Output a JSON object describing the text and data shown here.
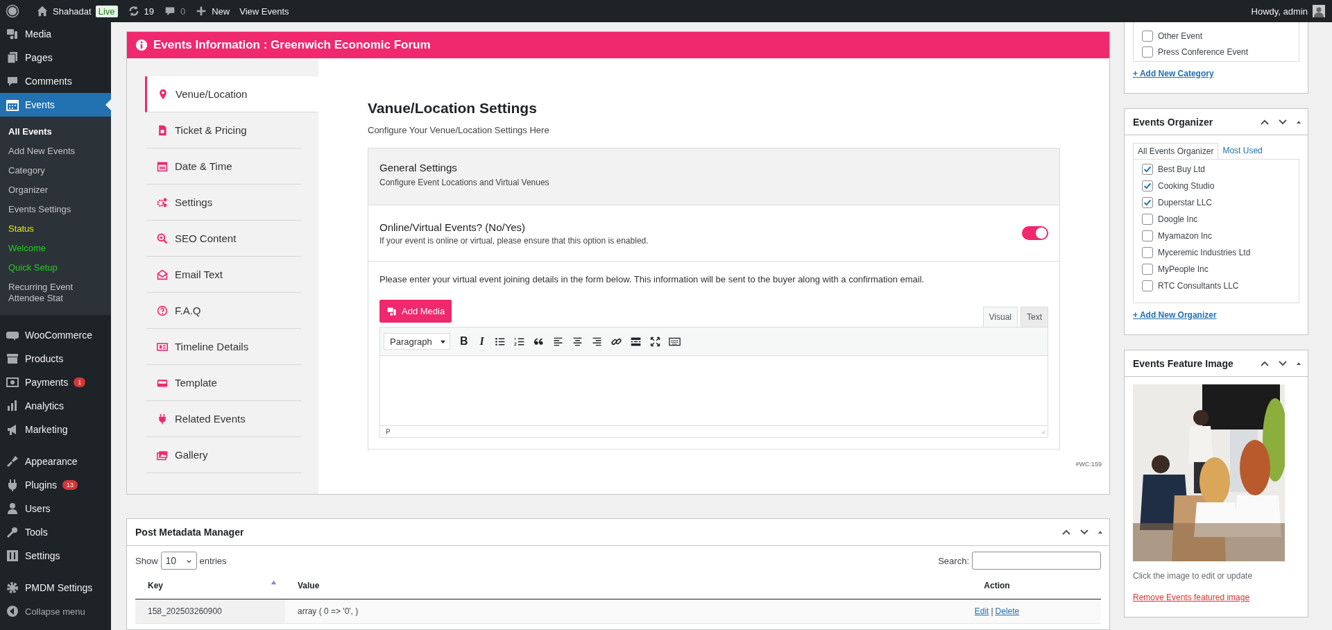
{
  "admin_bar": {
    "site_name": "Shahadat",
    "live_badge": "Live",
    "updates_count": "19",
    "comments_count": "0",
    "new_label": "New",
    "view_label": "View Events",
    "greeting": "Howdy, admin"
  },
  "sidebar": {
    "sections": [
      [
        {
          "label": "Media",
          "selected": false
        },
        {
          "label": "Pages",
          "selected": false
        },
        {
          "label": "Comments",
          "selected": false
        },
        {
          "label": "Events",
          "selected": true,
          "children": [
            {
              "label": "All Events",
              "selected": true
            },
            {
              "label": "Add New Events",
              "selected": false
            },
            {
              "label": "Category",
              "selected": false
            },
            {
              "label": "Organizer",
              "selected": false
            },
            {
              "label": "Events Settings",
              "selected": false
            },
            {
              "label": "Status",
              "selected": false,
              "color": "#e6e600"
            },
            {
              "label": "Welcome",
              "selected": false,
              "color": "#22cc22"
            },
            {
              "label": "Quick Setup",
              "selected": false,
              "color": "#22cc22"
            },
            {
              "label": "Recurring Event Attendee Stat",
              "selected": false
            }
          ]
        }
      ],
      [
        {
          "label": "WooCommerce",
          "selected": false
        },
        {
          "label": "Products",
          "selected": false
        },
        {
          "label": "Payments",
          "selected": false,
          "badge": "1"
        },
        {
          "label": "Analytics",
          "selected": false
        },
        {
          "label": "Marketing",
          "selected": false
        }
      ],
      [
        {
          "label": "Appearance",
          "selected": false
        },
        {
          "label": "Plugins",
          "selected": false,
          "badge": "13"
        },
        {
          "label": "Users",
          "selected": false
        },
        {
          "label": "Tools",
          "selected": false
        },
        {
          "label": "Settings",
          "selected": false
        }
      ],
      [
        {
          "label": "PMDM Settings",
          "selected": false
        }
      ]
    ],
    "collapse_label": "Collapse menu"
  },
  "events_panel": {
    "title": "Events Information : Greenwich Economic Forum",
    "tabs": [
      {
        "label": "Venue/Location",
        "selected": true
      },
      {
        "label": "Ticket & Pricing",
        "selected": false
      },
      {
        "label": "Date & Time",
        "selected": false
      },
      {
        "label": "Settings",
        "selected": false
      },
      {
        "label": "SEO Content",
        "selected": false
      },
      {
        "label": "Email Text",
        "selected": false
      },
      {
        "label": "F.A.Q",
        "selected": false
      },
      {
        "label": "Timeline Details",
        "selected": false
      },
      {
        "label": "Template",
        "selected": false
      },
      {
        "label": "Related Events",
        "selected": false
      },
      {
        "label": "Gallery",
        "selected": false
      }
    ],
    "heading": "Vanue/Location Settings",
    "subheading": "Configure Your Venue/Location Settings Here",
    "general": {
      "title": "General Settings",
      "subtitle": "Configure Event Locations and Virtual Venues"
    },
    "online": {
      "label": "Online/Virtual Events? (No/Yes)",
      "hint": "If your event is online or virtual, please ensure that this option is enabled.",
      "on": true
    },
    "instructions": "Please enter your virtual event joining details in the form below. This information will be sent to the buyer along with a confirmation email.",
    "add_media": "Add Media",
    "editor": {
      "modes": [
        {
          "label": "Visual",
          "selected": true
        },
        {
          "label": "Text",
          "selected": false
        }
      ],
      "format": "Paragraph",
      "toolbar": [
        {
          "kind": "bold",
          "text": "B"
        },
        {
          "kind": "italic",
          "text": "I"
        },
        {
          "kind": "bullets"
        },
        {
          "kind": "numbers"
        },
        {
          "kind": "quote"
        },
        {
          "kind": "align-left"
        },
        {
          "kind": "align-center"
        },
        {
          "kind": "align-right"
        },
        {
          "kind": "link"
        },
        {
          "kind": "more"
        },
        {
          "kind": "fullscreen"
        },
        {
          "kind": "keyboard"
        }
      ],
      "path": "P"
    },
    "footer_code": "#WC:159"
  },
  "metadata": {
    "title": "Post Metadata Manager",
    "show_label": "Show",
    "page_size": "10",
    "entries_label": "entries",
    "search_label": "Search:",
    "columns": [
      {
        "label": "Key",
        "sorted": true
      },
      {
        "label": "Value",
        "sorted": false
      },
      {
        "label": "Action",
        "sorted": false
      }
    ],
    "rows": [
      {
        "key": "158_202503260900",
        "value": "array ( 0 => '0', )",
        "actions": [
          "Edit",
          "Delete"
        ]
      }
    ],
    "action_separator": "|"
  },
  "category_box": {
    "items": [
      {
        "label": "Other Event",
        "checked": false
      },
      {
        "label": "Press Conference Event",
        "checked": false
      }
    ],
    "add_link": "+ Add New Category"
  },
  "organizer_box": {
    "title": "Events Organizer",
    "tabs": [
      {
        "label": "All Events Organizer",
        "selected": true
      },
      {
        "label": "Most Used",
        "selected": false
      }
    ],
    "items": [
      {
        "label": "Best Buy Ltd",
        "checked": true
      },
      {
        "label": "Cooking Studio",
        "checked": true
      },
      {
        "label": "Duperstar LLC",
        "checked": true
      },
      {
        "label": "Doogle Inc",
        "checked": false
      },
      {
        "label": "Myamazon Inc",
        "checked": false
      },
      {
        "label": "Myceremic Industries Ltd",
        "checked": false
      },
      {
        "label": "MyPeople Inc",
        "checked": false
      },
      {
        "label": "RTC Consultants LLC",
        "checked": false
      }
    ],
    "add_link": "+ Add New Organizer"
  },
  "image_box": {
    "title": "Events Feature Image",
    "hint": "Click the image to edit or update",
    "remove_link": "Remove Events featured image"
  }
}
